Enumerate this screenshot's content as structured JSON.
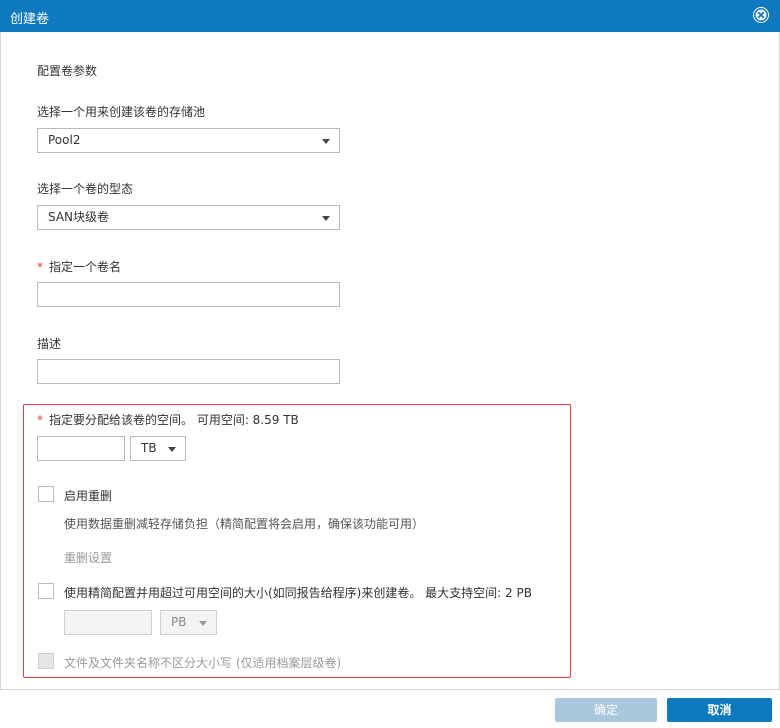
{
  "dialog": {
    "title": "创建卷",
    "close_icon": "close-circle-icon"
  },
  "section_title": "配置卷参数",
  "pool": {
    "label": "选择一个用来创建该卷的存储池",
    "selected": "Pool2"
  },
  "volume_type": {
    "label": "选择一个卷的型态",
    "selected": "SAN块级卷"
  },
  "volume_name": {
    "required_mark": "*",
    "label": "指定一个卷名",
    "value": ""
  },
  "description": {
    "label": "描述",
    "value": ""
  },
  "capacity": {
    "required_mark": "*",
    "label": "指定要分配给该卷的空间。 可用空间: 8.59 TB",
    "value": "",
    "unit": "TB"
  },
  "dedup": {
    "label": "启用重删",
    "hint": "使用数据重删减轻存储负担（精简配置将会启用，确保该功能可用）",
    "settings_link": "重删设置",
    "checked": false
  },
  "thin_provisioning": {
    "label": "使用精简配置并用超过可用空间的大小(如同报告给程序)来创建卷。 最大支持空间: 2 PB",
    "value": "",
    "unit": "PB",
    "checked": false
  },
  "case_insensitive": {
    "label": "文件及文件夹名称不区分大小写 (仅适用档案层级卷)",
    "checked": false
  },
  "footer": {
    "confirm_label": "确定",
    "cancel_label": "取消"
  },
  "colors": {
    "titlebar": "#0f79bf",
    "highlight_border": "#e0403b",
    "confirm_disabled": "#a9c7dd",
    "cancel": "#0f79bf"
  }
}
